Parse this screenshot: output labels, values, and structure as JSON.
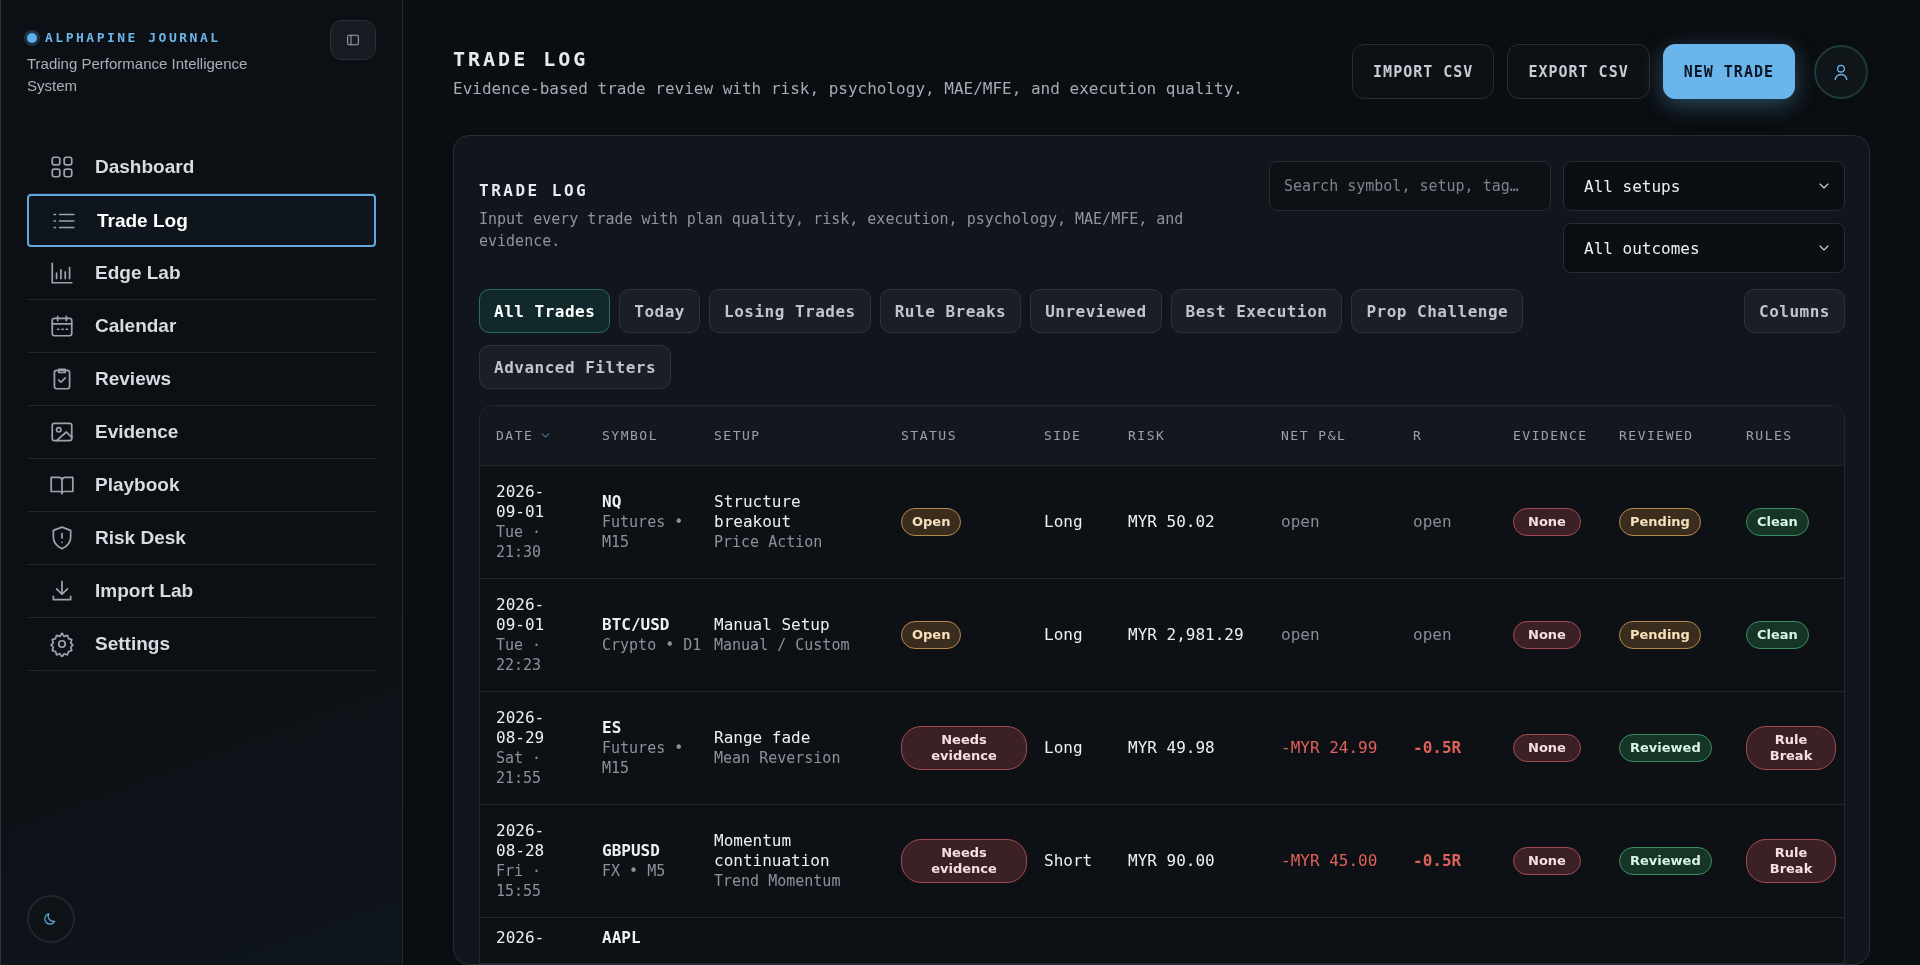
{
  "sidebar": {
    "brand": "ALPHAPINE JOURNAL",
    "tagline": "Trading Performance Intelligence System",
    "items": [
      {
        "label": "Dashboard",
        "selected": false
      },
      {
        "label": "Trade Log",
        "selected": true
      },
      {
        "label": "Edge Lab",
        "selected": false
      },
      {
        "label": "Calendar",
        "selected": false
      },
      {
        "label": "Reviews",
        "selected": false
      },
      {
        "label": "Evidence",
        "selected": false
      },
      {
        "label": "Playbook",
        "selected": false
      },
      {
        "label": "Risk Desk",
        "selected": false
      },
      {
        "label": "Import Lab",
        "selected": false
      },
      {
        "label": "Settings",
        "selected": false
      }
    ]
  },
  "header": {
    "title": "TRADE LOG",
    "subtitle": "Evidence-based trade review with risk, psychology, MAE/MFE, and execution quality.",
    "buttons": [
      {
        "label": "IMPORT CSV",
        "kind": "secondary"
      },
      {
        "label": "EXPORT CSV",
        "kind": "secondary"
      },
      {
        "label": "NEW TRADE",
        "kind": "primary"
      }
    ]
  },
  "card": {
    "title": "TRADE LOG",
    "description": "Input every trade with plan quality, risk, execution, psychology, MAE/MFE, and evidence.",
    "search": {
      "placeholder": "Search symbol, setup, tag…"
    },
    "selects": [
      "All setups",
      "All outcomes"
    ],
    "filters": [
      {
        "label": "All Trades",
        "selected": true
      },
      {
        "label": "Today",
        "selected": false
      },
      {
        "label": "Losing Trades",
        "selected": false
      },
      {
        "label": "Rule Breaks",
        "selected": false
      },
      {
        "label": "Unreviewed",
        "selected": false
      },
      {
        "label": "Best Execution",
        "selected": false
      },
      {
        "label": "Prop Challenge",
        "selected": false
      }
    ],
    "columns_button": "Columns",
    "advanced_button": "Advanced Filters"
  },
  "table": {
    "columns": [
      {
        "label": "DATE",
        "sorted": true
      },
      {
        "label": "SYMBOL",
        "sorted": false
      },
      {
        "label": "SETUP",
        "sorted": false
      },
      {
        "label": "STATUS",
        "sorted": false
      },
      {
        "label": "SIDE",
        "sorted": false
      },
      {
        "label": "RISK",
        "sorted": false
      },
      {
        "label": "NET P&L",
        "sorted": false
      },
      {
        "label": "R",
        "sorted": false
      },
      {
        "label": "EVIDENCE",
        "sorted": false
      },
      {
        "label": "REVIEWED",
        "sorted": false
      },
      {
        "label": "RULES",
        "sorted": false
      }
    ],
    "rows": [
      {
        "date": "2026-09-01",
        "day": "Tue · 21:30",
        "symbol": "NQ",
        "market": "Futures • M15",
        "setup": "Structure breakout",
        "strategy": "Price Action",
        "status": {
          "text": "Open",
          "kind": "warning"
        },
        "side": "Long",
        "risk": "MYR 50.02",
        "pnl": {
          "text": "open",
          "kind": "muted"
        },
        "r": {
          "text": "open",
          "kind": "muted"
        },
        "evidence": {
          "text": "None",
          "kind": "danger"
        },
        "reviewed": {
          "text": "Pending",
          "kind": "warning"
        },
        "rules": {
          "text": "Clean",
          "kind": "success"
        }
      },
      {
        "date": "2026-09-01",
        "day": "Tue · 22:23",
        "symbol": "BTC/USD",
        "market": "Crypto • D1",
        "setup": "Manual Setup",
        "strategy": "Manual / Custom",
        "status": {
          "text": "Open",
          "kind": "warning"
        },
        "side": "Long",
        "risk": "MYR 2,981.29",
        "pnl": {
          "text": "open",
          "kind": "muted"
        },
        "r": {
          "text": "open",
          "kind": "muted"
        },
        "evidence": {
          "text": "None",
          "kind": "danger"
        },
        "reviewed": {
          "text": "Pending",
          "kind": "warning"
        },
        "rules": {
          "text": "Clean",
          "kind": "success"
        }
      },
      {
        "date": "2026-08-29",
        "day": "Sat · 21:55",
        "symbol": "ES",
        "market": "Futures • M15",
        "setup": "Range fade",
        "strategy": "Mean Reversion",
        "status": {
          "text": "Needs evidence",
          "kind": "danger"
        },
        "side": "Long",
        "risk": "MYR 49.98",
        "pnl": {
          "text": "-MYR 24.99",
          "kind": "loss"
        },
        "r": {
          "text": "-0.5R",
          "kind": "loss_bold"
        },
        "evidence": {
          "text": "None",
          "kind": "danger"
        },
        "reviewed": {
          "text": "Reviewed",
          "kind": "success"
        },
        "rules": {
          "text": "Rule Break",
          "kind": "danger"
        }
      },
      {
        "date": "2026-08-28",
        "day": "Fri · 15:55",
        "symbol": "GBPUSD",
        "market": "FX • M5",
        "setup": "Momentum continuation",
        "strategy": "Trend Momentum",
        "status": {
          "text": "Needs evidence",
          "kind": "danger"
        },
        "side": "Short",
        "risk": "MYR 90.00",
        "pnl": {
          "text": "-MYR 45.00",
          "kind": "loss"
        },
        "r": {
          "text": "-0.5R",
          "kind": "loss_bold"
        },
        "evidence": {
          "text": "None",
          "kind": "danger"
        },
        "reviewed": {
          "text": "Reviewed",
          "kind": "success"
        },
        "rules": {
          "text": "Rule Break",
          "kind": "danger"
        }
      },
      {
        "date": "2026-",
        "symbol": "AAPL"
      }
    ]
  }
}
